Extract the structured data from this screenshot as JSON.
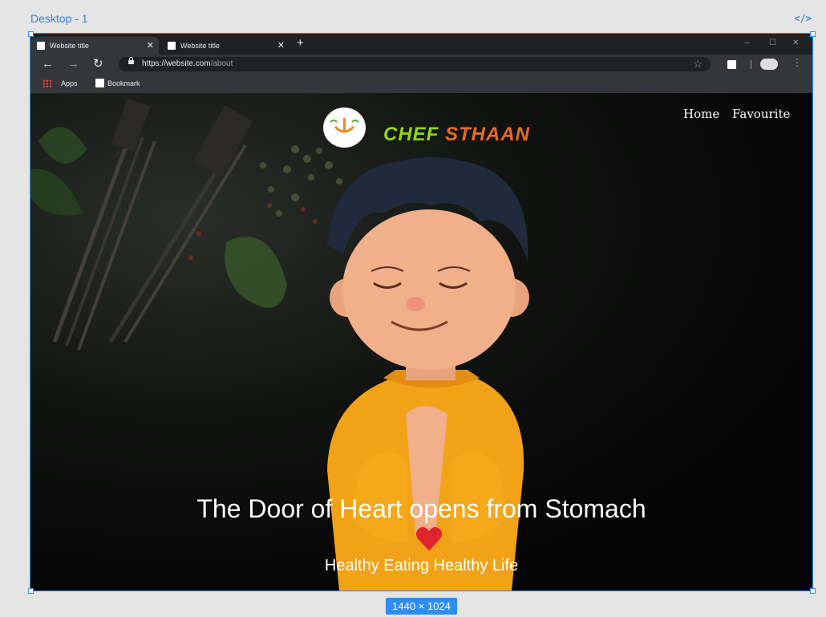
{
  "editor": {
    "frame_label": "Desktop - 1",
    "code_icon": "</>",
    "size_badge": "1440 × 1024"
  },
  "browser": {
    "tabs": [
      {
        "title": "Website title",
        "close": "✕"
      },
      {
        "title": "Website title",
        "close": "✕"
      }
    ],
    "new_tab": "+",
    "window_controls": {
      "minimize": "–",
      "maximize": "☐",
      "close": "✕"
    },
    "nav": {
      "back": "←",
      "forward": "→",
      "reload": "↻"
    },
    "url_host": "https://website.com",
    "url_path": "/about",
    "bookmarks": [
      {
        "label": "Apps"
      },
      {
        "label": "Bookmark"
      }
    ]
  },
  "site": {
    "brand_part1": "CHEF",
    "brand_part2": "STHAAN",
    "nav": [
      "Home",
      "Favourite"
    ],
    "hero_title": "The Door of Heart opens from Stomach",
    "hero_subtitle": "Healthy Eating Healthy Life",
    "colors": {
      "brand_green": "#8fd61a",
      "brand_orange": "#ea6a24",
      "heart": "#e0242e",
      "selection": "#2e8df0"
    }
  }
}
